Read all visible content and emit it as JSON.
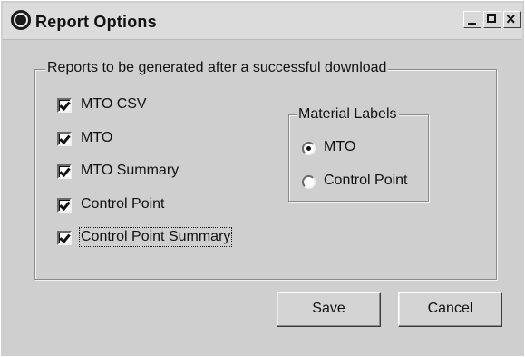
{
  "window": {
    "title": "Report Options",
    "controls": {
      "minimize": "_",
      "maximize": "□",
      "close": "×"
    }
  },
  "reports_group": {
    "legend": "Reports to be generated after a successful download",
    "checkboxes": [
      {
        "label": "MTO CSV",
        "checked": true
      },
      {
        "label": "MTO",
        "checked": true
      },
      {
        "label": "MTO Summary",
        "checked": true
      },
      {
        "label": "Control Point",
        "checked": true
      },
      {
        "label": "Control Point Summary",
        "checked": true,
        "focused": true
      }
    ]
  },
  "material_labels_group": {
    "legend": "Material Labels",
    "options": [
      {
        "label": "MTO",
        "selected": true
      },
      {
        "label": "Control Point",
        "selected": false
      }
    ]
  },
  "buttons": {
    "save": "Save",
    "cancel": "Cancel"
  }
}
